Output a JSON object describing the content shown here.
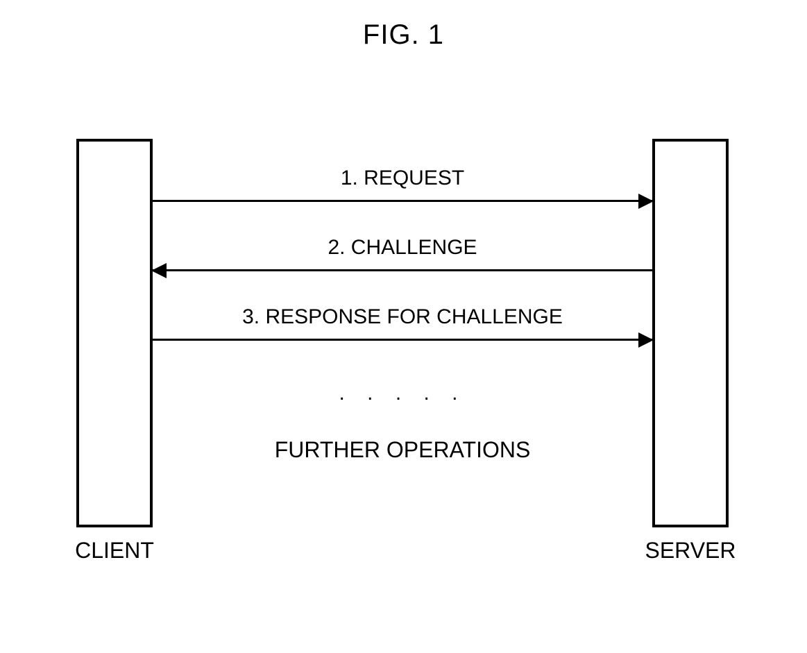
{
  "title": "FIG.  1",
  "client_label": "CLIENT",
  "server_label": "SERVER",
  "messages": {
    "m1": "1. REQUEST",
    "m2": "2. CHALLENGE",
    "m3": "3. RESPONSE FOR CHALLENGE"
  },
  "ellipsis": ". . . . .",
  "further": "FURTHER OPERATIONS"
}
